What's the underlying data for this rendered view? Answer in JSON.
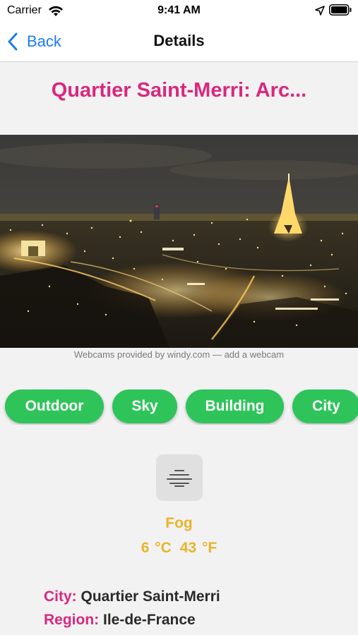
{
  "status_bar": {
    "carrier": "Carrier",
    "time": "9:41 AM",
    "icons": [
      "wifi-icon",
      "location-arrow-icon",
      "battery-icon"
    ]
  },
  "nav": {
    "back_label": "Back",
    "title": "Details",
    "back_icon": "chevron-left-icon",
    "accent_color": "#1a7cf3"
  },
  "webcam": {
    "title": "Quartier Saint-Merri: Arc...",
    "title_color": "#d9287e",
    "credit_prefix": "Webcams provided by ",
    "credit_link": "windy.com",
    "credit_sep": " — ",
    "credit_add": "add a webcam"
  },
  "tags": {
    "items": [
      "Outdoor",
      "Sky",
      "Building",
      "City"
    ],
    "color": "#2ec45a"
  },
  "weather": {
    "icon": "fog-icon",
    "condition": "Fog",
    "temp_c": "6 °C",
    "temp_f": "43 °F",
    "color": "#e8b42a"
  },
  "location": {
    "city_label": "City:",
    "city_value": "Quartier Saint-Merri",
    "region_label": "Region:",
    "region_value": "Ile-de-France"
  }
}
